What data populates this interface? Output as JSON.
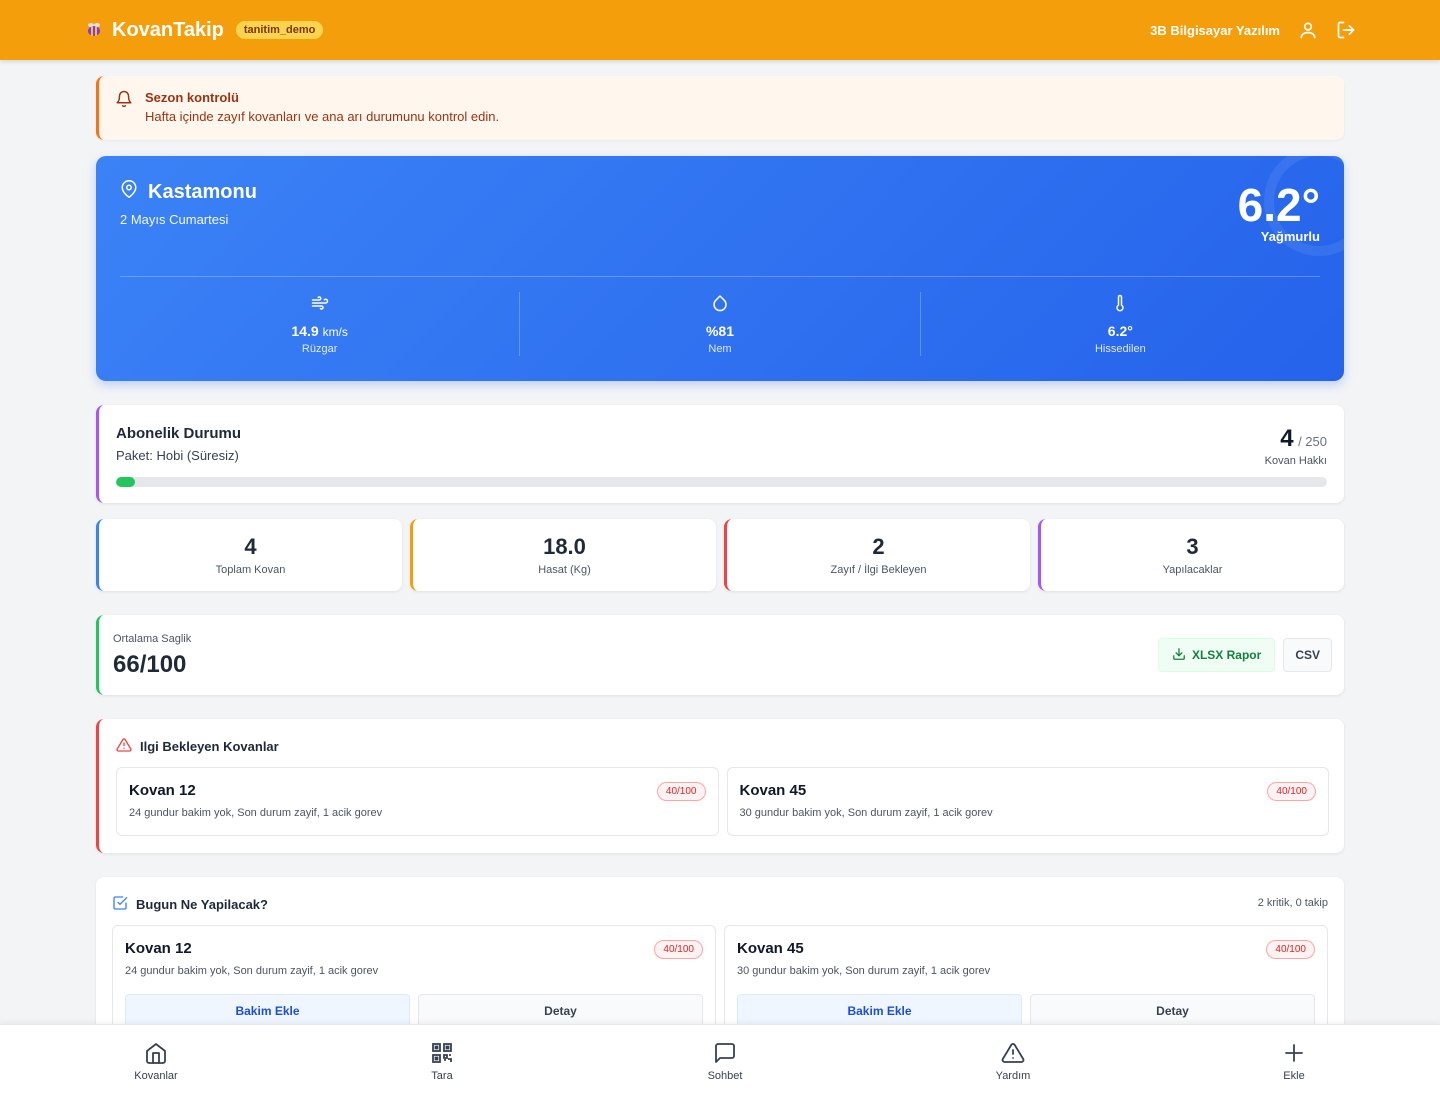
{
  "header": {
    "app_name": "KovanTakip",
    "badge": "tanitim_demo",
    "company": "3B Bilgisayar Yazılım",
    "icons": {
      "logo": "bee-icon",
      "profile": "user-icon",
      "logout": "logout-icon"
    }
  },
  "alert": {
    "title": "Sezon kontrolü",
    "text": "Hafta içinde zayıf kovanları ve ana arı durumunu kontrol edin.",
    "icon": "bell-icon"
  },
  "weather": {
    "location": "Kastamonu",
    "date": "2 Mayıs Cumartesi",
    "temperature": "6.2°",
    "condition": "Yağmurlu",
    "wind": {
      "value": "14.9",
      "unit": "km/s",
      "label": "Rüzgar",
      "icon": "wind-icon"
    },
    "humidity": {
      "value": "%81",
      "label": "Nem",
      "icon": "droplet-icon"
    },
    "feels_like": {
      "value": "6.2°",
      "label": "Hissedilen",
      "icon": "thermometer-icon"
    }
  },
  "subscription": {
    "title": "Abonelik Durumu",
    "plan": "Paket: Hobi (Süresiz)",
    "used": "4",
    "max": "/ 250",
    "label": "Kovan Hakkı",
    "usage_fraction": 0.016
  },
  "stats": [
    {
      "value": "4",
      "label": "Toplam Kovan",
      "color": "#3b82f6"
    },
    {
      "value": "18.0",
      "label": "Hasat (Kg)",
      "color": "#f59e0b"
    },
    {
      "value": "2",
      "label": "Zayıf / İlgi Bekleyen",
      "color": "#ef4444"
    },
    {
      "value": "3",
      "label": "Yapılacaklar",
      "color": "#a855f7"
    }
  ],
  "health": {
    "label": "Ortalama Saglik",
    "value": "66/100",
    "xlsx_label": "XLSX Rapor",
    "csv_label": "CSV"
  },
  "attention": {
    "title": "Ilgi Bekleyen Kovanlar",
    "icon": "warning-icon",
    "hives": [
      {
        "name": "Kovan 12",
        "score": "40/100",
        "desc": "24 gundur bakim yok, Son durum zayif, 1 acik gorev"
      },
      {
        "name": "Kovan 45",
        "score": "40/100",
        "desc": "30 gundur bakim yok, Son durum zayif, 1 acik gorev"
      }
    ]
  },
  "todo": {
    "title": "Bugun Ne Yapilacak?",
    "meta": "2 kritik, 0 takip",
    "icon": "check-square-icon",
    "items": [
      {
        "name": "Kovan 12",
        "score": "40/100",
        "desc": "24 gundur bakim yok, Son durum zayif, 1 acik gorev",
        "primary": "Bakim Ekle",
        "secondary": "Detay"
      },
      {
        "name": "Kovan 45",
        "score": "40/100",
        "desc": "30 gundur bakim yok, Son durum zayif, 1 acik gorev",
        "primary": "Bakim Ekle",
        "secondary": "Detay"
      }
    ]
  },
  "bottom_nav": [
    {
      "label": "Kovanlar",
      "icon": "home-icon"
    },
    {
      "label": "Tara",
      "icon": "qr-code-icon"
    },
    {
      "label": "Sohbet",
      "icon": "chat-icon"
    },
    {
      "label": "Yardım",
      "icon": "alert-triangle-icon"
    },
    {
      "label": "Ekle",
      "icon": "plus-icon"
    }
  ]
}
